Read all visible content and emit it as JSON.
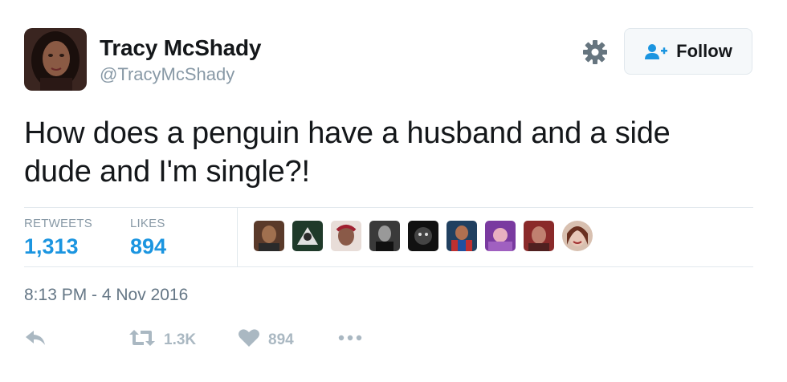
{
  "user": {
    "name": "Tracy McShady",
    "handle": "@TracyMcShady"
  },
  "follow_button": {
    "label": "Follow",
    "icon": "add-user-icon"
  },
  "settings_icon": "gear-icon",
  "tweet": {
    "text_line1": "How does a penguin have a husband and a side",
    "text_line2": "dude and I'm single?!",
    "timestamp": "8:13 PM - 4 Nov 2016"
  },
  "stats": {
    "retweets_label": "RETWEETS",
    "retweets_value": "1,313",
    "likes_label": "LIKES",
    "likes_value": "894"
  },
  "actions": {
    "reply_icon": "reply-icon",
    "retweet_icon": "retweet-icon",
    "retweet_count": "1.3K",
    "like_icon": "heart-icon",
    "like_count": "894",
    "more_icon": "more-icon"
  },
  "colors": {
    "link_blue": "#1b95e0",
    "muted": "#8899a6",
    "icon_gray": "#aab8c2"
  }
}
